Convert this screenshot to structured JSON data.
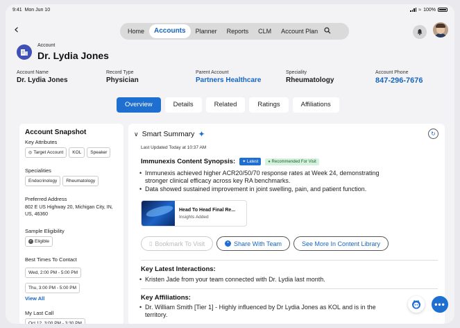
{
  "status": {
    "time": "9:41",
    "date": "Mon Jun 10",
    "battery": "100%"
  },
  "nav": {
    "items": [
      "Home",
      "Accounts",
      "Planner",
      "Reports",
      "CLM",
      "Account Plan"
    ],
    "active": "Accounts"
  },
  "account": {
    "type_label": "Account",
    "name": "Dr. Lydia Jones"
  },
  "fields": [
    {
      "label": "Account Name",
      "value": "Dr. Lydia Jones"
    },
    {
      "label": "Record Type",
      "value": "Physician"
    },
    {
      "label": "Parent Account",
      "value": "Partners Healthcare"
    },
    {
      "label": "Speciality",
      "value": "Rheumatology"
    },
    {
      "label": "Account Phone",
      "value": "847-296-7676"
    }
  ],
  "tabs": [
    "Overview",
    "Details",
    "Related",
    "Ratings",
    "Affiliations"
  ],
  "snapshot": {
    "title": "Account Snapshot",
    "key_attributes_label": "Key Attributes",
    "key_attributes": [
      "Target Account",
      "KOL",
      "Speaker"
    ],
    "specialities_label": "Specialities",
    "specialities": [
      "Endocrinology",
      "Rheumatology"
    ],
    "address_label": "Preferred Address",
    "address": "802 E US Highway 20, Michigan City, IN, US, 46360",
    "sample_label": "Sample Eligibility",
    "sample_value": "Eligible",
    "times_label": "Best Times To Contact",
    "times": [
      "Wed, 2:00 PM - 5:00 PM",
      "Thu, 3:00 PM - 5:00 PM"
    ],
    "view_all": "View All",
    "last_call_label": "My Last Call",
    "last_call": "Oct 12, 3:00 PM - 3:30 PM"
  },
  "summary": {
    "title": "Smart Summary",
    "updated": "Last Updated Today at 10:37 AM",
    "synopsis_title": "Immunexis Content Synopsis:",
    "badge_latest": "Latest",
    "badge_rec": "Recommended For Visit",
    "bullets": [
      "Immunexis achieved higher ACR20/50/70 response rates at Week 24, demonstrating",
      "stronger clinical efficacy across key RA benchmarks.",
      "Data showed sustained improvement in joint swelling, pain, and patient function."
    ],
    "card_title": "Head To Head Final Re...",
    "card_sub": "Insights Added",
    "btn_bookmark": "Bookmark To Visit",
    "btn_share": "Share With Team",
    "btn_more": "See More In Content Library",
    "interactions_title": "Key Latest Interactions:",
    "interaction": "Kristen Jade from your team connected with Dr. Lydia last month.",
    "affiliations_title": "Key Affiliations:",
    "affiliation_1": "Dr. William Smith [Tier 1] - Highly influenced by Dr Lydia Jones as KOL and is in the",
    "affiliation_1b": "territory."
  }
}
